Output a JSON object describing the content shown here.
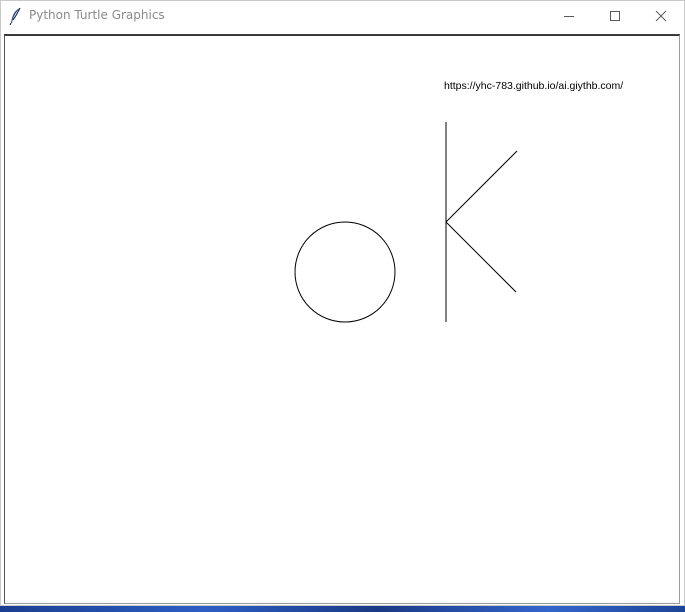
{
  "window": {
    "title": "Python Turtle Graphics",
    "app_icon": "feather-icon"
  },
  "controls": {
    "minimize_icon": "minimize-icon",
    "maximize_icon": "maximize-icon",
    "close_icon": "close-icon"
  },
  "canvas": {
    "text": "https://yhc-783.github.io/ai.giythb.com/",
    "background": "#ffffff",
    "pen_color": "#000000",
    "drawing": "circle and letter K"
  },
  "colors": {
    "title_text": "#8a8a8a",
    "desktop_accent": "#2c5fc4"
  }
}
